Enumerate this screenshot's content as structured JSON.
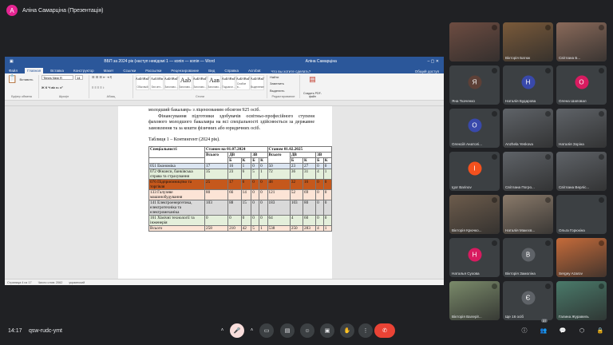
{
  "meet": {
    "presenter": {
      "initial": "А",
      "name": "Аліна Самарціна (Презентація)"
    },
    "clock": "14:17",
    "meeting_code": "qsw-rudc-ymt",
    "participant_badge": "37"
  },
  "word": {
    "title": "ВБП за 2024 рік (наступ невідомі 1 — копія — копія — Word",
    "user": "Аліна Самарціна",
    "tabs": [
      "Файл",
      "Главная",
      "Вставка",
      "Конструктор",
      "Макет",
      "Ссылки",
      "Рассылки",
      "Рецензирование",
      "Вид",
      "Справка",
      "Acrobat"
    ],
    "tell_me": "Что вы хотите сделать?",
    "share": "Общий доступ",
    "ribbon": {
      "paste": "Вставить",
      "clipboard_label": "Буфер обмена",
      "font_name": "Times New R",
      "font_size": "14",
      "font_label": "Шрифт",
      "paragraph_label": "Абзац",
      "styles_label": "Стили",
      "find": "Найти",
      "replace": "Заменить",
      "select": "Выделить",
      "edit_label": "Редактирование",
      "pdf": "Создать PDF-файл",
      "styles": [
        {
          "sample": "АаБбВвГ",
          "name": "Обычный"
        },
        {
          "sample": "АаБбВв",
          "name": "Без инт..."
        },
        {
          "sample": "АаБбВвГ",
          "name": "Заголово..."
        },
        {
          "sample": "Ааb",
          "name": "Заголово..."
        },
        {
          "sample": "АаБбВвГ",
          "name": "Заголово..."
        },
        {
          "sample": "Аав",
          "name": "Заголово..."
        },
        {
          "sample": "АаБбВвГ",
          "name": "Подзагол..."
        },
        {
          "sample": "АаБбВвГ",
          "name": "Слабое в..."
        },
        {
          "sample": "АаБбВвГ",
          "name": "Выделение"
        }
      ]
    },
    "document": {
      "line1": "молодший бакалавр» з ліцензованим обсягом 925 осіб.",
      "para2": "Фінансування підготовки здобувачів освітньо-професійного ступеня фахового молодшого бакалавра на всі спеціальності здійснюється за державне замовлення та за кошти фізичних або юридичних осіб.",
      "caption": "Таблиця 1 – Контингент (2024 рік).",
      "table": {
        "h_spec": "Спеціальності",
        "h_2024": "Станом на 01.07.2024",
        "h_2025": "Станом 01.02.2025",
        "all": "Всього",
        "dv": "ДВ",
        "zv": "ЗВ",
        "b": "Б",
        "k": "К",
        "rows": [
          {
            "name": "051 Економіка",
            "v": [
              "17",
              "16",
              "1",
              "0",
              "0",
              "50",
              "23",
              "27",
              "0",
              "0"
            ],
            "bg": "#dbe5f1"
          },
          {
            "name": "072 Фінанси, банківська справа та страхування",
            "v": [
              "35",
              "23",
              "6",
              "5",
              "1",
              "72",
              "36",
              "31",
              "4",
              "1"
            ],
            "bg": "#e4efdb"
          },
          {
            "name": "076 Підприємництво та торгівля",
            "v": [
              "25",
              "17",
              "6",
              "0",
              "0",
              "48",
              "32",
              "16",
              "0",
              "0"
            ],
            "bg": "#c5581c"
          },
          {
            "name": "133 Галузеве машинобудування",
            "v": [
              "80",
              "66",
              "14",
              "0",
              "0",
              "121",
              "52",
              "69",
              "0",
              "0"
            ],
            "bg": "#fce4d6"
          },
          {
            "name": "141 Електроенергетика, електротехніка та електромеханіка",
            "v": [
              "103",
              "88",
              "15",
              "0",
              "0",
              "183",
              "103",
              "80",
              "0",
              "0"
            ],
            "bg": "#d9d9d9"
          },
          {
            "name": "161 Хімічні технології та інженерія",
            "v": [
              "0",
              "0",
              "0",
              "0",
              "0",
              "64",
              "4",
              "60",
              "0",
              "0"
            ],
            "bg": "#e4efdb"
          },
          {
            "name": "Всього",
            "v": [
              "258",
              "210",
              "42",
              "5",
              "1",
              "538",
              "250",
              "283",
              "4",
              "1"
            ],
            "bg": "#fce4d6"
          }
        ]
      }
    },
    "status": {
      "page": "Страница 4 из 17",
      "words": "Число слов: 2062",
      "lang": "украинский"
    }
  },
  "participants": [
    {
      "name": "",
      "initial": "",
      "color": "#6d4c41",
      "video": true
    },
    {
      "name": "Вікторія Батюк",
      "initial": "",
      "color": "#7a5a3a",
      "video": true
    },
    {
      "name": "Світлана Б...",
      "initial": "",
      "color": "#8a6a5a",
      "video": true
    },
    {
      "name": "Яна Ткаченко",
      "initial": "Я",
      "color": "#5d4037"
    },
    {
      "name": "Наталія Бударова",
      "initial": "Н",
      "color": "#3949ab"
    },
    {
      "name": "Олена Шаповал",
      "initial": "О",
      "color": "#d81b60"
    },
    {
      "name": "Олексій Анатолі...",
      "initial": "О",
      "color": "#3949ab"
    },
    {
      "name": "Anzhela Yeskova",
      "initial": "",
      "color": "#5f6368",
      "video": true
    },
    {
      "name": "Наталія Зоріна",
      "initial": "",
      "color": "#5f6368",
      "video": true
    },
    {
      "name": "Igor Barinov",
      "initial": "I",
      "color": "#f4511e"
    },
    {
      "name": "Світлана Погро...",
      "initial": "",
      "color": "#5f6368",
      "video": true
    },
    {
      "name": "Світлана Верліс...",
      "initial": "",
      "color": "#5f6368",
      "video": true
    },
    {
      "name": "Вікторія Крючко...",
      "initial": "",
      "color": "#6d5c4c",
      "video": true
    },
    {
      "name": "Наталія Макєєв...",
      "initial": "",
      "color": "#8a7a6a",
      "video": true
    },
    {
      "name": "Ольга Горюкіна",
      "initial": "",
      "color": "#3c4043"
    },
    {
      "name": "Наталья Сухова",
      "initial": "Н",
      "color": "#d81b60"
    },
    {
      "name": "Вікторія Замоліна",
      "initial": "В",
      "color": "#5f6368"
    },
    {
      "name": "Sergey Azarov",
      "initial": "",
      "color": "#c56b3a",
      "video": true
    },
    {
      "name": "Вікторія Валерії...",
      "initial": "",
      "color": "#7a8a6a",
      "video": true
    },
    {
      "name": "Ще 16 осіб",
      "initial": "Є",
      "color": "#5f6368"
    },
    {
      "name": "Галина Журавель",
      "initial": "",
      "color": "#4a7a6a",
      "video": true
    }
  ]
}
